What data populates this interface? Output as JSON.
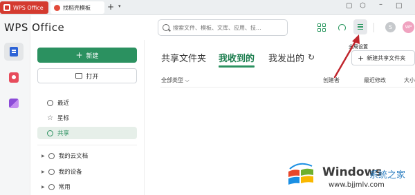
{
  "titlebar": {
    "tab_app": "WPS Office",
    "tab_doc": "找稻壳模板",
    "add_tab": "+",
    "menu_arrow": "▾"
  },
  "header": {
    "brand": "WPS Office",
    "search_placeholder": "搜索文件、模板、文库、应用、技...",
    "avatar_text": "WP",
    "tooltip": "全局设置"
  },
  "sidebar": {
    "new_label": "新建",
    "open_label": "打开",
    "items": [
      {
        "label": "最近"
      },
      {
        "label": "星标"
      },
      {
        "label": "共享"
      }
    ],
    "folders": [
      {
        "label": "我的云文档"
      },
      {
        "label": "我的设备"
      },
      {
        "label": "常用"
      }
    ]
  },
  "main": {
    "tabs": [
      {
        "label": "共享文件夹"
      },
      {
        "label": "我收到的"
      },
      {
        "label": "我发出的"
      }
    ],
    "new_share_folder": "新建共享文件夹",
    "columns": {
      "type": "全部类型",
      "creator": "创建者",
      "modified": "最近修改",
      "size": "大小"
    }
  },
  "watermark": {
    "windows": "Windows",
    "subtitle": "系统之家",
    "url": "www.bjjmlv.com"
  },
  "colors": {
    "accent": "#2b9160",
    "app_red": "#d43a2f",
    "arrow": "#c0262d"
  }
}
